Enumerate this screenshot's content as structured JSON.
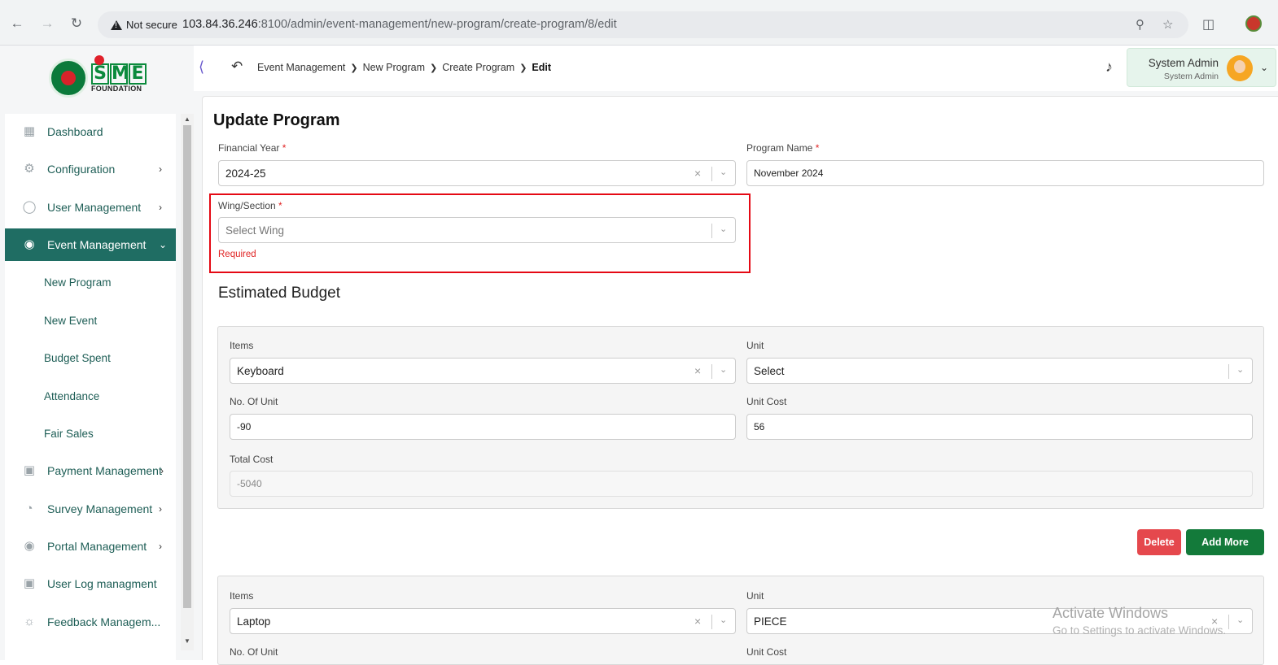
{
  "browser": {
    "security_label": "Not secure",
    "url_host": "103.84.36.246",
    "url_rest": ":8100/admin/event-management/new-program/create-program/8/edit"
  },
  "logo": {
    "letters": [
      "S",
      "M",
      "E"
    ],
    "foundation": "FOUNDATION"
  },
  "sidebar": {
    "items": [
      {
        "label": "Dashboard",
        "icon": "grid-icon"
      },
      {
        "label": "Configuration",
        "icon": "config-icon"
      },
      {
        "label": "User Management",
        "icon": "shield-icon"
      },
      {
        "label": "Event Management",
        "icon": "lock-icon"
      },
      {
        "label": "Payment Management",
        "icon": "payment-icon"
      },
      {
        "label": "Survey Management",
        "icon": "pie-icon"
      },
      {
        "label": "Portal Management",
        "icon": "lock-icon"
      },
      {
        "label": "User Log managment",
        "icon": "log-icon"
      },
      {
        "label": "Feedback Managem...",
        "icon": "feedback-icon"
      }
    ],
    "sub_items": [
      "New Program",
      "New Event",
      "Budget Spent",
      "Attendance",
      "Fair Sales"
    ]
  },
  "breadcrumb": {
    "items": [
      "Event Management",
      "New Program",
      "Create Program"
    ],
    "current": "Edit"
  },
  "user": {
    "name": "System Admin",
    "role": "System Admin"
  },
  "form": {
    "title": "Update Program",
    "financial_year": {
      "label": "Financial Year",
      "value": "2024-25"
    },
    "program_name": {
      "label": "Program Name",
      "value": "November 2024"
    },
    "wing": {
      "label": "Wing/Section",
      "placeholder": "Select Wing",
      "error": "Required"
    },
    "required_mark": "*"
  },
  "budget": {
    "title": "Estimated Budget",
    "labels": {
      "items": "Items",
      "unit": "Unit",
      "no_of_unit": "No. Of Unit",
      "unit_cost": "Unit Cost",
      "total_cost": "Total Cost"
    },
    "entries": [
      {
        "item": "Keyboard",
        "unit": "Select",
        "no_of_unit": "-90",
        "unit_cost": "56",
        "total_cost": "-5040"
      },
      {
        "item": "Laptop",
        "unit": "PIECE"
      }
    ],
    "delete_label": "Delete",
    "add_more_label": "Add More"
  },
  "watermark": {
    "line1": "Activate Windows",
    "line2": "Go to Settings to activate Windows."
  }
}
